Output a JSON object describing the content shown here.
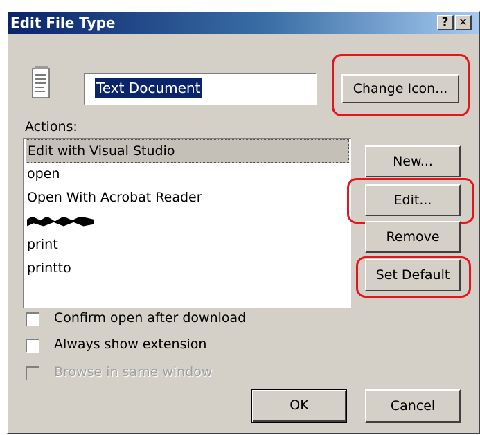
{
  "window": {
    "title": "Edit File Type",
    "help_glyph": "?",
    "close_glyph": "✕"
  },
  "file_type": {
    "icon": "text-document-icon",
    "name_value": "Text Document",
    "change_icon_label": "Change Icon..."
  },
  "actions": {
    "label": "Actions:",
    "items": [
      {
        "label": "Edit with Visual Studio"
      },
      {
        "label": "open"
      },
      {
        "label": "Open With Acrobat Reader"
      },
      {
        "label": "",
        "redacted": true
      },
      {
        "label": "print"
      },
      {
        "label": "printto"
      }
    ],
    "buttons": {
      "new": "New...",
      "edit": "Edit...",
      "remove": "Remove",
      "set_default": "Set Default"
    }
  },
  "options": {
    "confirm_open": "Confirm open after download",
    "always_show": "Always show extension",
    "browse_same": "Browse in same window"
  },
  "footer": {
    "ok": "OK",
    "cancel": "Cancel"
  },
  "colors": {
    "dialog_bg": "#d4d0c8",
    "title_gradient_start": "#0a246a",
    "highlight_annotation": "#e8141c",
    "selection": "#0a246a"
  }
}
